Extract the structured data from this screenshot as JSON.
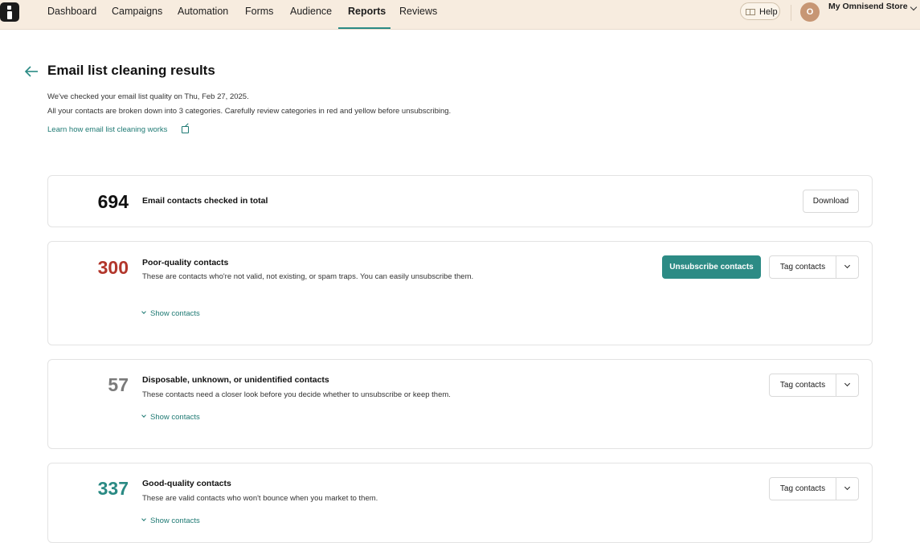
{
  "nav": {
    "items": [
      "Dashboard",
      "Campaigns",
      "Automation",
      "Forms",
      "Audience",
      "Reports",
      "Reviews"
    ],
    "active": "Reports",
    "help_label": "Help",
    "avatar_initial": "O",
    "store_name": "My Omnisend Store"
  },
  "header": {
    "title": "Email list cleaning results",
    "intro_line1": "We've checked your email list quality on Thu, Feb 27, 2025.",
    "intro_line2": "All your contacts are broken down into 3 categories. Carefully review categories in red and yellow before unsubscribing.",
    "learn_link": "Learn how email list cleaning works"
  },
  "summary": {
    "count": "694",
    "label": "Email contacts checked in total",
    "download_label": "Download"
  },
  "categories": [
    {
      "count": "300",
      "count_color": "#b2362b",
      "title": "Poor-quality contacts",
      "description": "These are contacts who're not valid, not existing, or spam traps. You can easily unsubscribe them.",
      "show_label": "Show contacts",
      "unsubscribe_label": "Unsubscribe contacts",
      "tag_label": "Tag contacts"
    },
    {
      "count": "57",
      "count_color": "#7a7a7a",
      "title": "Disposable, unknown, or unidentified contacts",
      "description": "These contacts need a closer look before you decide whether to unsubscribe or keep them.",
      "show_label": "Show contacts",
      "tag_label": "Tag contacts"
    },
    {
      "count": "337",
      "count_color": "#2a8a84",
      "title": "Good-quality contacts",
      "description": "These are valid contacts who won't bounce when you market to them.",
      "show_label": "Show contacts",
      "tag_label": "Tag contacts"
    }
  ],
  "colors": {
    "accent": "#2c8b85",
    "topbar_bg": "#f7ecdf",
    "poor": "#b2362b",
    "neutral": "#7a7a7a",
    "good": "#2a8a84"
  }
}
